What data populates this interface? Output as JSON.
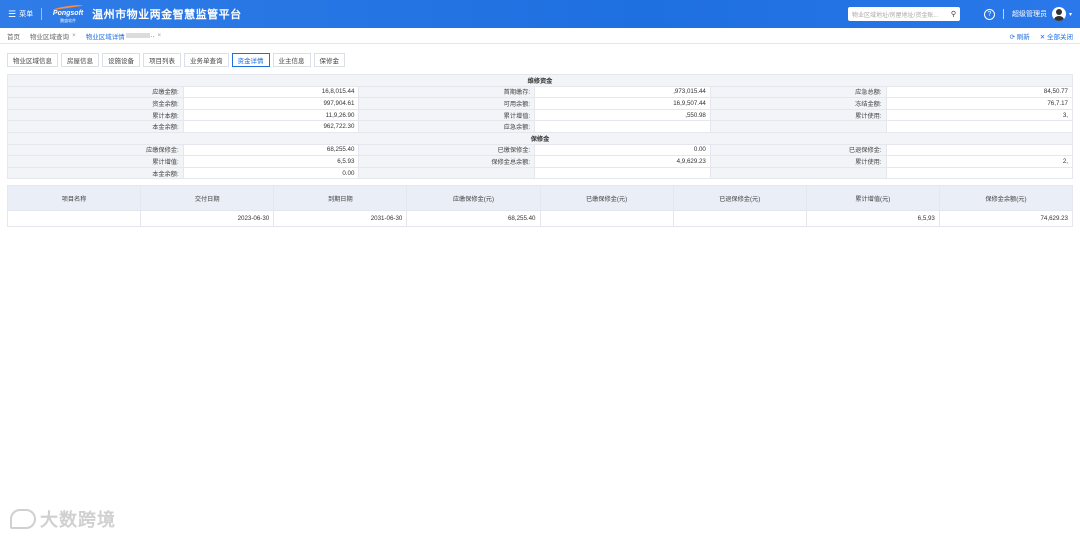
{
  "header": {
    "menu_label": "菜单",
    "brand": "Pongsoft",
    "brand_sub": "鹏盛软件",
    "title": "温州市物业两金智慧监管平台",
    "search_placeholder": "物业区域地址/房屋地址/资金账...",
    "user_name": "超级管理员"
  },
  "tabbar": {
    "crumbs": [
      {
        "label": "首页",
        "closable": false
      },
      {
        "label": "物业区域查询",
        "closable": true
      },
      {
        "label": "物业区域详情",
        "closable": true
      }
    ],
    "refresh_label": "刷新",
    "close_all_label": "全部关闭"
  },
  "subtabs": [
    "物业区域信息",
    "房屋信息",
    "设施设备",
    "项目列表",
    "业务单查询",
    "资金详情",
    "业主信息",
    "保修金"
  ],
  "active_subtab": 5,
  "maintenance_fund": {
    "title": "维修资金",
    "rows": [
      [
        {
          "label": "应缴金额:",
          "value": "16,8,015.44"
        },
        {
          "label": "首期缴存:",
          "value": ",973,015.44"
        },
        {
          "label": "应急总额:",
          "value": "84,50.77"
        }
      ],
      [
        {
          "label": "资金余额:",
          "value": "997,904.61"
        },
        {
          "label": "可用余额:",
          "value": "16,9,507.44"
        },
        {
          "label": "冻结金额:",
          "value": "76,7.17"
        }
      ],
      [
        {
          "label": "累计本额:",
          "value": "11,9,26.90"
        },
        {
          "label": "累计增值:",
          "value": ",550.98"
        },
        {
          "label": "累计使用:",
          "value": "3,"
        }
      ],
      [
        {
          "label": "本金余额:",
          "value": "962,722.30"
        },
        {
          "label": "应急余额:",
          "value": ""
        },
        {
          "label": "",
          "value": ""
        }
      ]
    ]
  },
  "warranty_fund": {
    "title": "保修金",
    "rows": [
      [
        {
          "label": "应缴保修金:",
          "value": "68,255.40"
        },
        {
          "label": "已缴保修金:",
          "value": "0.00"
        },
        {
          "label": "已退保修金:",
          "value": ""
        }
      ],
      [
        {
          "label": "累计增值:",
          "value": "6,5.93"
        },
        {
          "label": "保修金总余额:",
          "value": "4,9,629.23"
        },
        {
          "label": "累计使用:",
          "value": "2,"
        }
      ],
      [
        {
          "label": "本金余额:",
          "value": "0.00"
        },
        {
          "label": "",
          "value": ""
        },
        {
          "label": "",
          "value": ""
        }
      ]
    ]
  },
  "project_table": {
    "headers": [
      "项目名称",
      "交付日期",
      "到期日期",
      "应缴保修金(元)",
      "已缴保修金(元)",
      "已退保修金(元)",
      "累计增值(元)",
      "保修金余额(元)"
    ],
    "rows": [
      [
        "",
        "2023-06-30",
        "2031-06-30",
        "68,255.40",
        "",
        "",
        "6,5,93",
        "74,629.23"
      ]
    ]
  },
  "watermark": "大数跨境",
  "colors": {
    "primary": "#1e6fe0",
    "header_bg": "#2f7ce8",
    "label_bg": "#f2f4f7",
    "th_bg": "#e9eef7"
  }
}
